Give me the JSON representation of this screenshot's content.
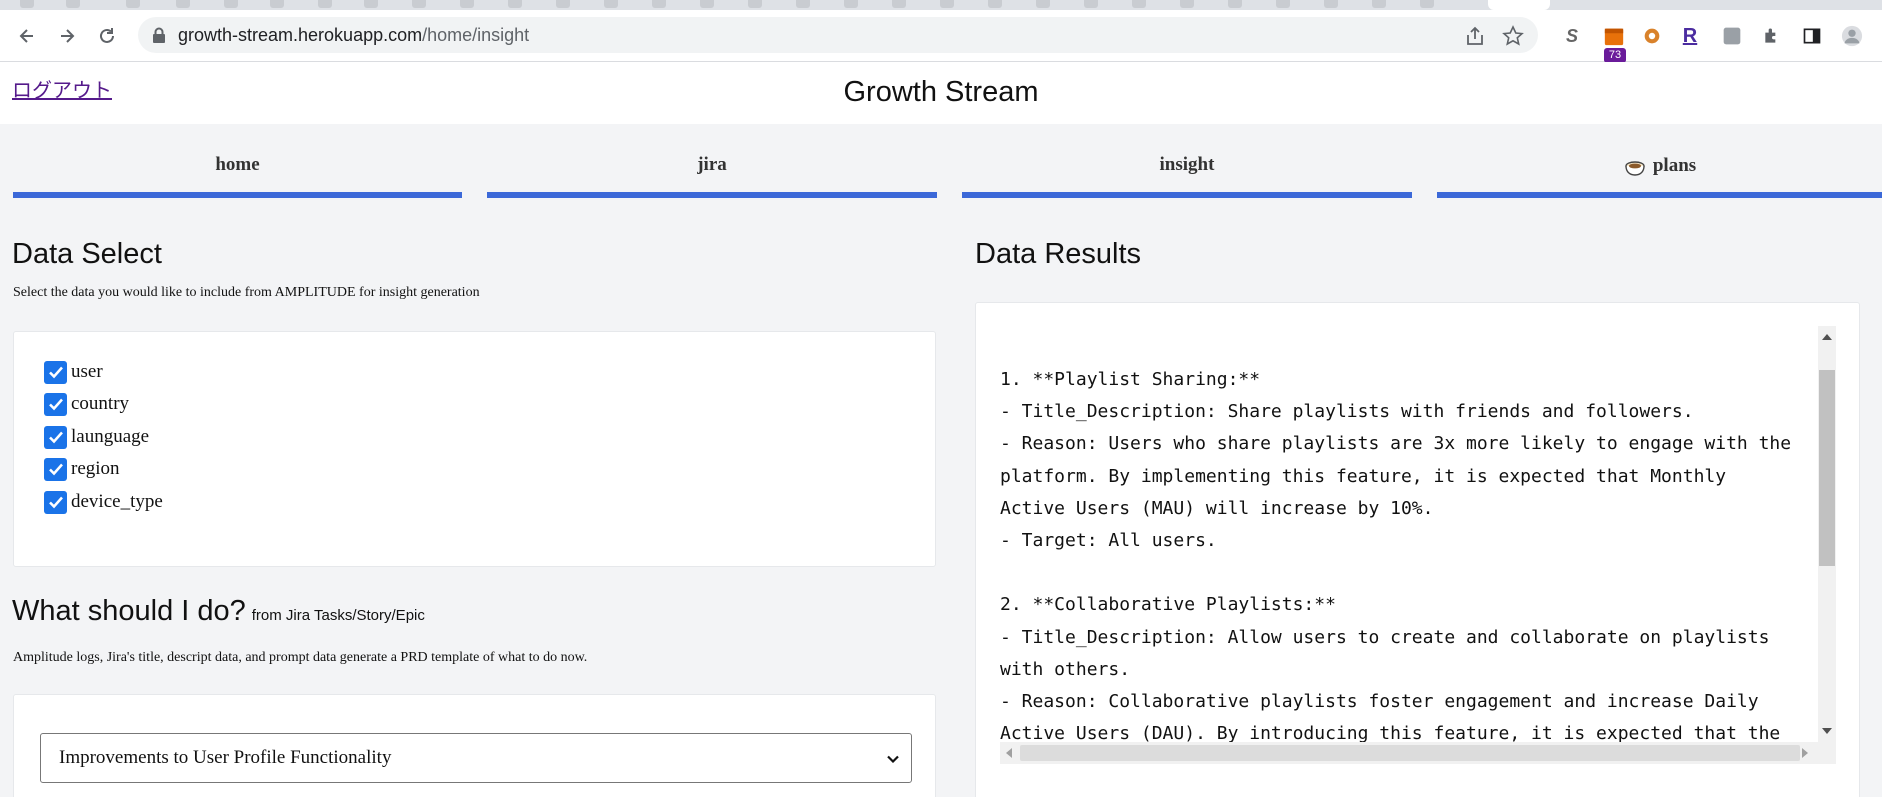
{
  "browser": {
    "url_host": "growth-stream.herokuapp.com",
    "url_path": "/home/insight",
    "extension_badge": "73",
    "ext_s": "S",
    "ext_r": "R"
  },
  "header": {
    "logout_label": "ログアウト",
    "title": "Growth Stream"
  },
  "nav": {
    "items": [
      {
        "label": "home"
      },
      {
        "label": "jira"
      },
      {
        "label": "insight"
      },
      {
        "label": "plans"
      }
    ]
  },
  "data_select": {
    "title": "Data Select",
    "description": "Select the data you would like to include from AMPLITUDE for insight generation",
    "options": [
      {
        "label": "user",
        "checked": true
      },
      {
        "label": "country",
        "checked": true
      },
      {
        "label": "launguage",
        "checked": true
      },
      {
        "label": "region",
        "checked": true
      },
      {
        "label": "device_type",
        "checked": true
      }
    ]
  },
  "what_should": {
    "title": "What should I do?",
    "subtitle": "from Jira Tasks/Story/Epic",
    "description": "Amplitude logs, Jira's title, descript data, and prompt data generate a PRD template of what to do now.",
    "selected": "Improvements to User Profile Functionality"
  },
  "data_results": {
    "title": "Data Results",
    "lines": [
      "1. **Playlist Sharing:**",
      "- Title_Description: Share playlists with friends and followers.",
      "- Reason: Users who share playlists are 3x more likely to engage with the",
      "platform. By implementing this feature, it is expected that Monthly",
      "Active Users (MAU) will increase by 10%.",
      "- Target: All users.",
      "",
      "2. **Collaborative Playlists:**",
      "- Title_Description: Allow users to create and collaborate on playlists",
      "with others.",
      "- Reason: Collaborative playlists foster engagement and increase Daily",
      "Active Users (DAU). By introducing this feature, it is expected that the"
    ]
  }
}
